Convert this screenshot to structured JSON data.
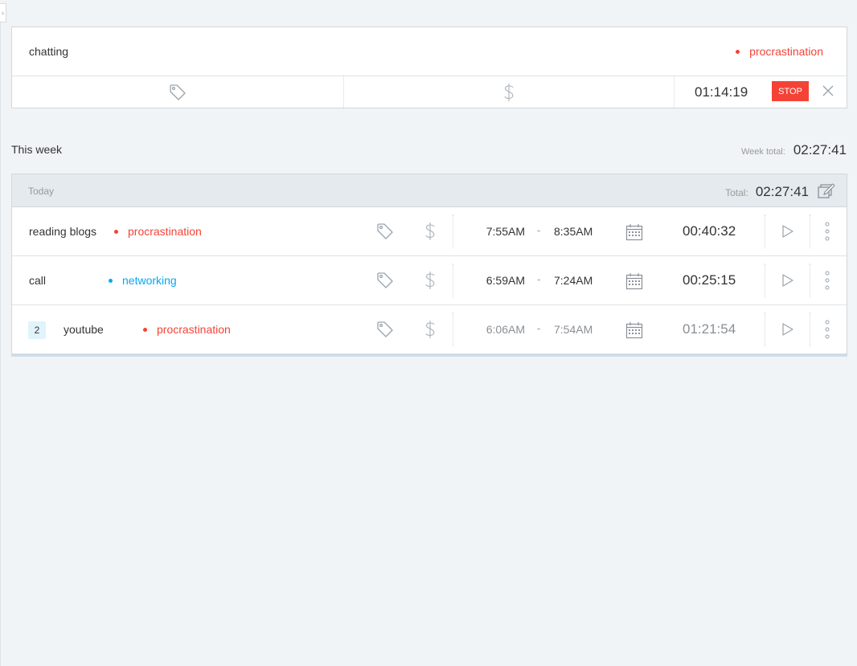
{
  "sidebar_toggle": {
    "icon": "chevron-right-icon",
    "glyph": "›"
  },
  "timer": {
    "description": "chatting",
    "project": {
      "name": "procrastination",
      "color": "#f44336"
    },
    "elapsed": "01:14:19",
    "stop_label": "STOP",
    "stop_color": "#f44336"
  },
  "week": {
    "label": "This week",
    "total_label": "Week total:",
    "total": "02:27:41"
  },
  "day": {
    "name": "Today",
    "total_label": "Total:",
    "total": "02:27:41",
    "entries": [
      {
        "count": null,
        "description": "reading blogs",
        "project": {
          "name": "procrastination",
          "color": "#f44336"
        },
        "start": "7:55AM",
        "end": "8:35AM",
        "separator": "-",
        "duration": "00:40:32"
      },
      {
        "count": null,
        "description": "call",
        "project": {
          "name": "networking",
          "color": "#03a9f4"
        },
        "start": "6:59AM",
        "end": "7:24AM",
        "separator": "-",
        "duration": "00:25:15"
      },
      {
        "count": "2",
        "description": "youtube",
        "project": {
          "name": "procrastination",
          "color": "#f44336"
        },
        "start": "6:06AM",
        "end": "7:54AM",
        "separator": "-",
        "duration": "01:21:54"
      }
    ]
  }
}
